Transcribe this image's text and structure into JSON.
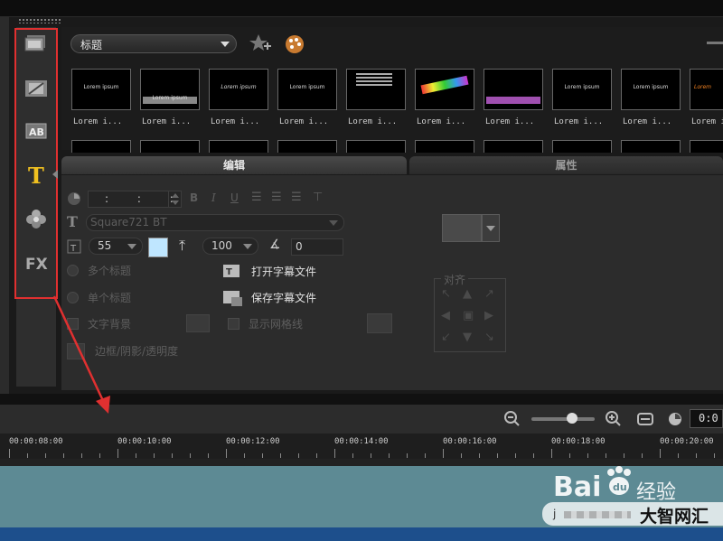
{
  "library": {
    "category": "标题",
    "thumbs": [
      {
        "label": "Lorem i...",
        "preview": "Lorem ipsum"
      },
      {
        "label": "Lorem i...",
        "preview": "Lorem ipsum"
      },
      {
        "label": "Lorem i...",
        "preview": "Lorem ipsum"
      },
      {
        "label": "Lorem i...",
        "preview": "Lorem ipsum"
      },
      {
        "label": "Lorem i...",
        "preview": ""
      },
      {
        "label": "Lorem i...",
        "preview": ""
      },
      {
        "label": "Lorem i...",
        "preview": ""
      },
      {
        "label": "Lorem i...",
        "preview": "Lorem ipsum"
      },
      {
        "label": "Lorem i...",
        "preview": "Lorem ipsum"
      },
      {
        "label": "Lorem i...",
        "preview": "Lorem"
      }
    ]
  },
  "tabs": {
    "edit": "编辑",
    "properties": "属性"
  },
  "edit": {
    "time": ": : :",
    "font": "Square721 BT",
    "font_size": "55",
    "line_spacing": "100",
    "angle": "0",
    "multi_title": "多个标题",
    "single_title": "单个标题",
    "text_bg": "文字背景",
    "show_grid": "显示网格线",
    "border_shadow": "边框/阴影/透明度",
    "open_subtitle": "打开字幕文件",
    "save_subtitle": "保存字幕文件",
    "align_label": "对齐",
    "color_swatch": "#bfe6ff"
  },
  "timeline": {
    "timecode": "0:0",
    "ticks": [
      "00:00:08:00",
      "00:00:10:00",
      "00:00:12:00",
      "00:00:14:00",
      "00:00:16:00",
      "00:00:18:00",
      "00:00:20:00"
    ]
  },
  "watermark": {
    "brand": "Bai",
    "sub": "经验",
    "site": "大智网汇",
    "tail": "j"
  }
}
